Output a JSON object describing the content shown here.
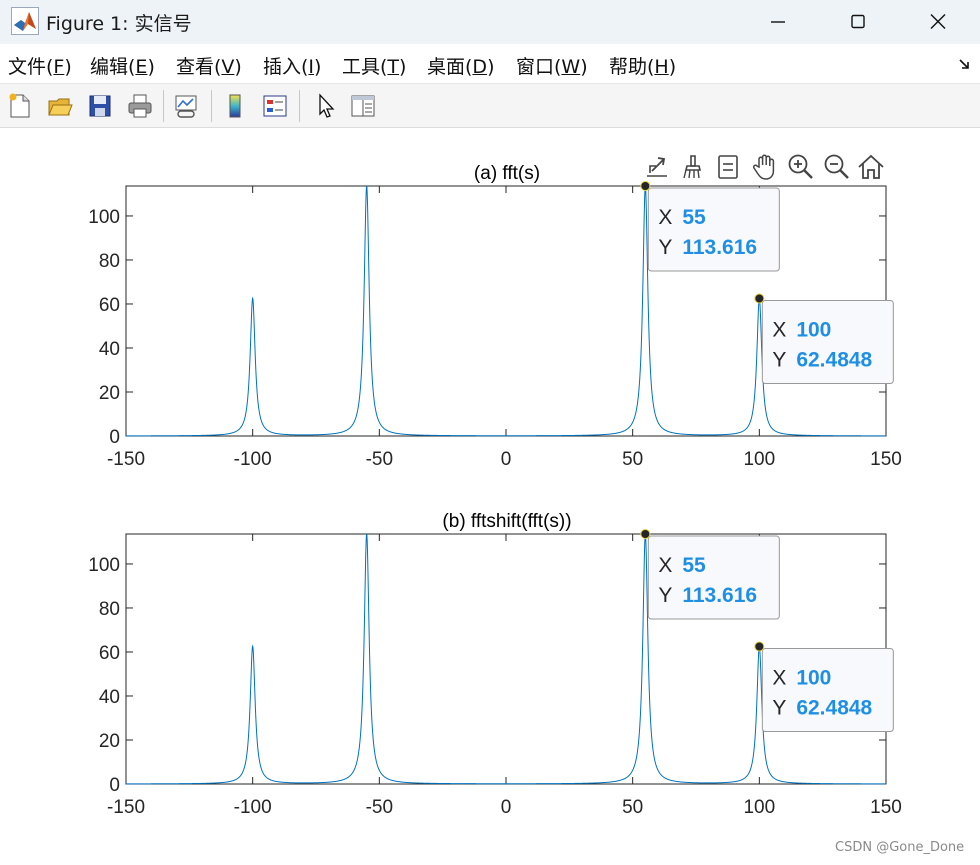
{
  "window": {
    "title": "Figure 1: 实信号",
    "minimize_label": "minimize",
    "maximize_label": "maximize",
    "close_label": "close"
  },
  "menu": [
    {
      "label": "文件(",
      "key": "F",
      "tail": ")"
    },
    {
      "label": "编辑(",
      "key": "E",
      "tail": ")"
    },
    {
      "label": "查看(",
      "key": "V",
      "tail": ")"
    },
    {
      "label": "插入(",
      "key": "I",
      "tail": ")"
    },
    {
      "label": "工具(",
      "key": "T",
      "tail": ")"
    },
    {
      "label": "桌面(",
      "key": "D",
      "tail": ")"
    },
    {
      "label": "窗口(",
      "key": "W",
      "tail": ")"
    },
    {
      "label": "帮助(",
      "key": "H",
      "tail": ")"
    }
  ],
  "toolbar": [
    "new-figure-icon",
    "open-file-icon",
    "save-icon",
    "print-icon",
    "link-plot-icon",
    "colorbar-icon",
    "legend-icon",
    "pointer-icon",
    "property-inspector-icon"
  ],
  "axes_toolbar": [
    "export-icon",
    "brush-icon",
    "data-tips-icon",
    "pan-icon",
    "zoom-in-icon",
    "zoom-out-icon",
    "home-icon"
  ],
  "colors": {
    "line": "#0072BD",
    "datatip_value": "#1F8FE5",
    "datatip_label": "#262626",
    "datatip_border": "#999999",
    "marker": "#262626"
  },
  "chart_data": [
    {
      "type": "line",
      "title": "(a) fft(s)",
      "xlim": [
        -150,
        150
      ],
      "ylim": [
        0,
        113.616
      ],
      "xticks": [
        -150,
        -100,
        -50,
        0,
        50,
        100,
        150
      ],
      "yticks": [
        0,
        20,
        40,
        60,
        80,
        100
      ],
      "grid": false,
      "peaks": [
        {
          "x": -100,
          "y": 62.4848
        },
        {
          "x": -55,
          "y": 113.616
        },
        {
          "x": 55,
          "y": 113.616
        },
        {
          "x": 100,
          "y": 62.4848
        }
      ],
      "datatips": [
        {
          "x_label": "X",
          "x": "55",
          "y_label": "Y",
          "y": "113.616"
        },
        {
          "x_label": "X",
          "x": "100",
          "y_label": "Y",
          "y": "62.4848"
        }
      ]
    },
    {
      "type": "line",
      "title": "(b) fftshift(fft(s))",
      "xlim": [
        -150,
        150
      ],
      "ylim": [
        0,
        113.616
      ],
      "xticks": [
        -150,
        -100,
        -50,
        0,
        50,
        100,
        150
      ],
      "yticks": [
        0,
        20,
        40,
        60,
        80,
        100
      ],
      "grid": false,
      "peaks": [
        {
          "x": -100,
          "y": 62.4848
        },
        {
          "x": -55,
          "y": 113.616
        },
        {
          "x": 55,
          "y": 113.616
        },
        {
          "x": 100,
          "y": 62.4848
        }
      ],
      "datatips": [
        {
          "x_label": "X",
          "x": "55",
          "y_label": "Y",
          "y": "113.616"
        },
        {
          "x_label": "X",
          "x": "100",
          "y_label": "Y",
          "y": "62.4848"
        }
      ]
    }
  ],
  "watermark": "CSDN @Gone_Done"
}
